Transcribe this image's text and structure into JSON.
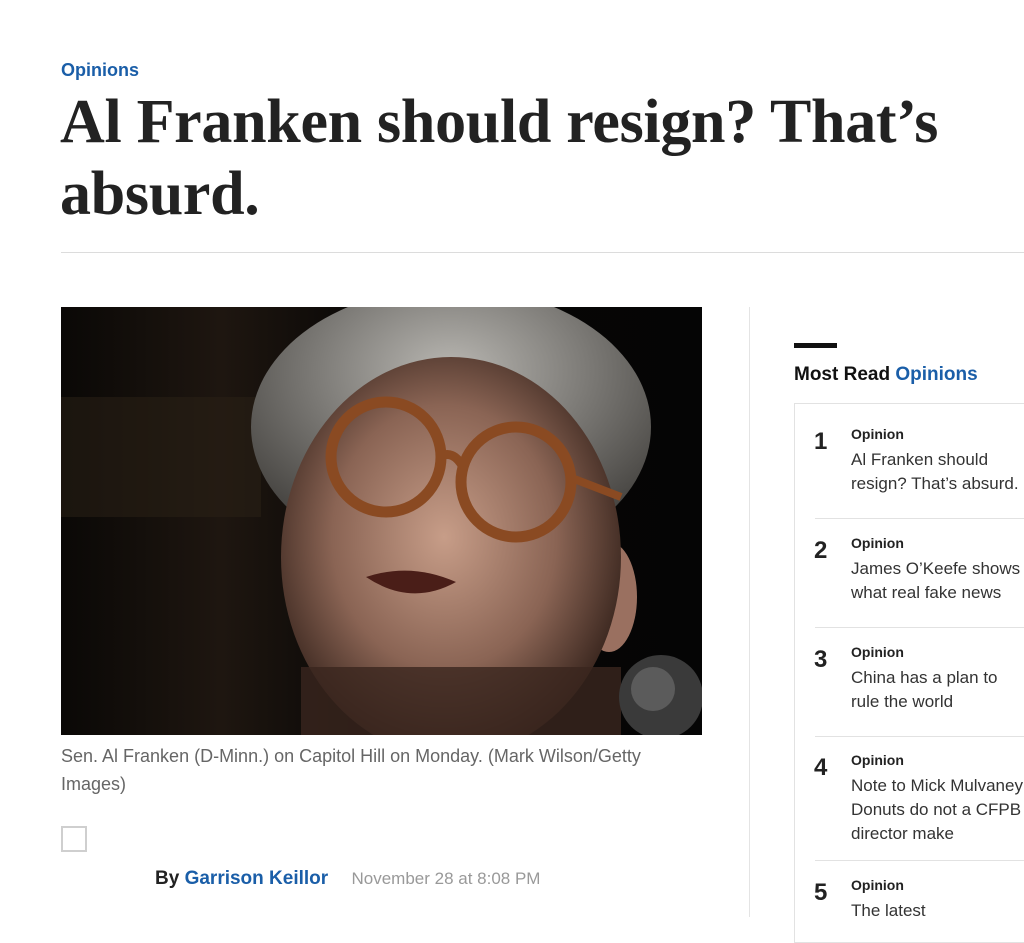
{
  "article": {
    "kicker": "Opinions",
    "headline": "Al Franken should resign? That’s absurd.",
    "caption": "Sen. Al Franken (D-Minn.) on Capitol Hill on Monday. (Mark Wilson/Getty Images)",
    "byline": {
      "by_label": "By",
      "author": "Garrison Keillor",
      "date": "November 28 at 8:08 PM"
    }
  },
  "most_read": {
    "title_prefix": "Most Read",
    "title_accent": "Opinions",
    "items": [
      {
        "number": "1",
        "label": "Opinion",
        "text": "Al Franken should\nresign? That’s absurd."
      },
      {
        "number": "2",
        "label": "Opinion",
        "text": "James O’Keefe shows\nwhat real fake news"
      },
      {
        "number": "3",
        "label": "Opinion",
        "text": "China has a plan to\nrule the world"
      },
      {
        "number": "4",
        "label": "Opinion",
        "text": "Note to Mick Mulvaney:\nDonuts do not a CFPB\ndirector make"
      },
      {
        "number": "5",
        "label": "Opinion",
        "text": "The latest"
      }
    ]
  },
  "colors": {
    "accent": "#1a5ea8",
    "headline": "#222222",
    "muted": "#999999"
  }
}
